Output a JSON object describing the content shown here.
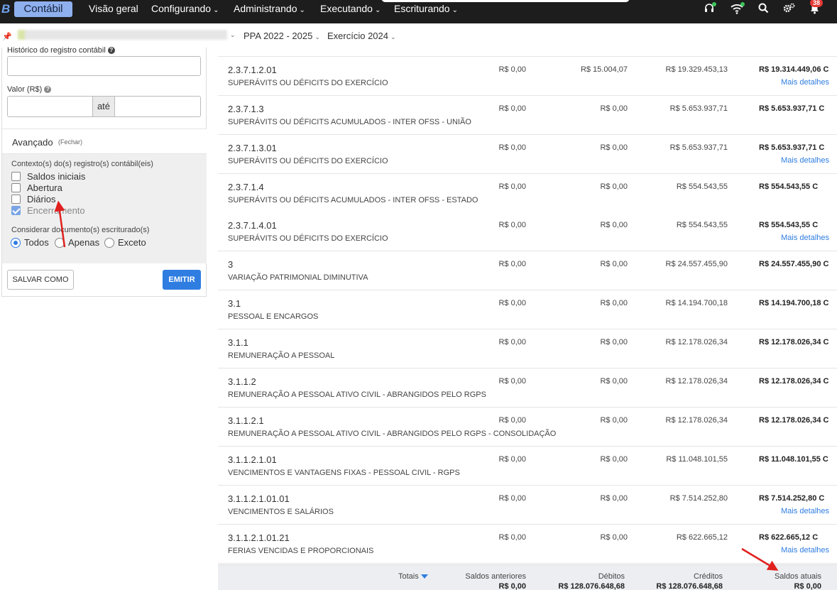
{
  "navbar": {
    "logo": "B",
    "module": "Contábil",
    "items": [
      {
        "label": "Visão geral",
        "has_menu": false
      },
      {
        "label": "Configurando",
        "has_menu": true
      },
      {
        "label": "Administrando",
        "has_menu": true
      },
      {
        "label": "Executando",
        "has_menu": true
      },
      {
        "label": "Escriturando",
        "has_menu": true
      }
    ],
    "notification_count": "38"
  },
  "breadcrumb": {
    "ppa": "PPA 2022 - 2025",
    "exercicio": "Exercício 2024"
  },
  "filters": {
    "historico_label": "Histórico do registro contábil",
    "valor_label": "Valor (R$)",
    "ate_label": "até",
    "advanced_title": "Avançado",
    "advanced_close": "(Fechar)",
    "contexto_label": "Contexto(s) do(s) registro(s) contábil(eis)",
    "contexto_options": [
      {
        "label": "Saldos iniciais",
        "checked": false
      },
      {
        "label": "Abertura",
        "checked": false
      },
      {
        "label": "Diários",
        "checked": false
      },
      {
        "label": "Encerramento",
        "checked": true
      }
    ],
    "documento_label": "Considerar documento(s) escriturado(s)",
    "documento_options": [
      "Todos",
      "Apenas",
      "Exceto"
    ],
    "documento_selected": "Todos",
    "save_button": "SALVAR COMO",
    "emit_button": "EMITIR"
  },
  "table": {
    "details_label": "Mais detalhes",
    "rows": [
      {
        "code": "2.3.7.1.2.01",
        "desc": "SUPERÁVITS OU DÉFICITS DO EXERCÍCIO",
        "anterior": "R$ 0,00",
        "debitos": "R$ 15.004,07",
        "creditos": "R$ 19.329.453,13",
        "atual": "R$ 19.314.449,06 C",
        "details": true
      },
      {
        "code": "2.3.7.1.3",
        "desc": "SUPERÁVITS OU DÉFICITS ACUMULADOS - INTER OFSS - UNIÃO",
        "anterior": "R$ 0,00",
        "debitos": "R$ 0,00",
        "creditos": "R$ 5.653.937,71",
        "atual": "R$ 5.653.937,71 C",
        "details": false
      },
      {
        "code": "2.3.7.1.3.01",
        "desc": "SUPERÁVITS OU DÉFICITS DO EXERCÍCIO",
        "anterior": "R$ 0,00",
        "debitos": "R$ 0,00",
        "creditos": "R$ 5.653.937,71",
        "atual": "R$ 5.653.937,71 C",
        "details": true
      },
      {
        "code": "2.3.7.1.4",
        "desc": "SUPERÁVITS OU DÉFICITS ACUMULADOS - INTER OFSS - ESTADO",
        "anterior": "R$ 0,00",
        "debitos": "R$ 0,00",
        "creditos": "R$ 554.543,55",
        "atual": "R$ 554.543,55 C",
        "details": false
      },
      {
        "code": "2.3.7.1.4.01",
        "desc": "SUPERÁVITS OU DÉFICITS DO EXERCÍCIO",
        "anterior": "R$ 0,00",
        "debitos": "R$ 0,00",
        "creditos": "R$ 554.543,55",
        "atual": "R$ 554.543,55 C",
        "details": true
      },
      {
        "code": "3",
        "desc": "VARIAÇÃO PATRIMONIAL DIMINUTIVA",
        "anterior": "R$ 0,00",
        "debitos": "R$ 0,00",
        "creditos": "R$ 24.557.455,90",
        "atual": "R$ 24.557.455,90 C",
        "details": false
      },
      {
        "code": "3.1",
        "desc": "PESSOAL E ENCARGOS",
        "anterior": "R$ 0,00",
        "debitos": "R$ 0,00",
        "creditos": "R$ 14.194.700,18",
        "atual": "R$ 14.194.700,18 C",
        "details": false
      },
      {
        "code": "3.1.1",
        "desc": "REMUNERAÇÃO A PESSOAL",
        "anterior": "R$ 0,00",
        "debitos": "R$ 0,00",
        "creditos": "R$ 12.178.026,34",
        "atual": "R$ 12.178.026,34 C",
        "details": false
      },
      {
        "code": "3.1.1.2",
        "desc": "REMUNERAÇÃO A PESSOAL ATIVO CIVIL - ABRANGIDOS PELO RGPS",
        "anterior": "R$ 0,00",
        "debitos": "R$ 0,00",
        "creditos": "R$ 12.178.026,34",
        "atual": "R$ 12.178.026,34 C",
        "details": false
      },
      {
        "code": "3.1.1.2.1",
        "desc": "REMUNERAÇÃO A PESSOAL ATIVO CIVIL - ABRANGIDOS PELO RGPS - CONSOLIDAÇÃO",
        "anterior": "R$ 0,00",
        "debitos": "R$ 0,00",
        "creditos": "R$ 12.178.026,34",
        "atual": "R$ 12.178.026,34 C",
        "details": false
      },
      {
        "code": "3.1.1.2.1.01",
        "desc": "VENCIMENTOS E VANTAGENS FIXAS - PESSOAL CIVIL - RGPS",
        "anterior": "R$ 0,00",
        "debitos": "R$ 0,00",
        "creditos": "R$ 11.048.101,55",
        "atual": "R$ 11.048.101,55 C",
        "details": false
      },
      {
        "code": "3.1.1.2.1.01.01",
        "desc": "VENCIMENTOS E SALÁRIOS",
        "anterior": "R$ 0,00",
        "debitos": "R$ 0,00",
        "creditos": "R$ 7.514.252,80",
        "atual": "R$ 7.514.252,80 C",
        "details": true
      },
      {
        "code": "3.1.1.2.1.01.21",
        "desc": "FERIAS VENCIDAS E PROPORCIONAIS",
        "anterior": "R$ 0,00",
        "debitos": "R$ 0,00",
        "creditos": "R$ 622.665,12",
        "atual": "R$ 622.665,12 C",
        "details": true
      }
    ]
  },
  "totals": {
    "label": "Totais",
    "anterior_label": "Saldos anteriores",
    "debitos_label": "Débitos",
    "creditos_label": "Créditos",
    "atual_label": "Saldos atuais",
    "anterior": "R$ 0,00",
    "debitos": "R$ 128.076.648,68",
    "creditos": "R$ 128.076.648,68",
    "atual": "R$ 0,00"
  },
  "colors": {
    "navbar": "#1d1d1d",
    "module_badge": "#8fb0ee",
    "primary": "#2f7de1",
    "annotation": "#e0201e"
  }
}
